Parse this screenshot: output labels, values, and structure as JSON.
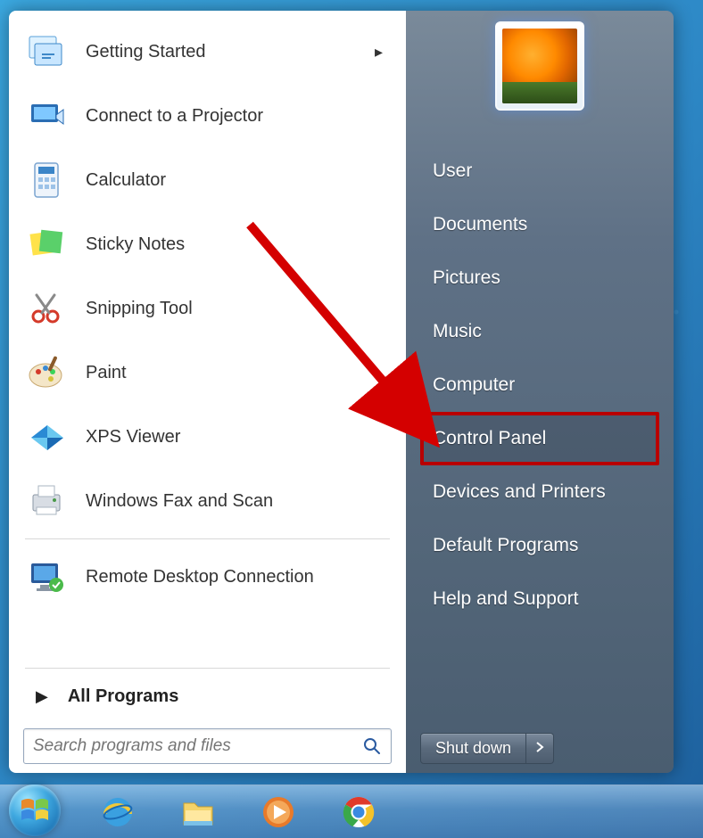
{
  "start_menu": {
    "programs": [
      {
        "label": "Getting Started",
        "has_submenu": true,
        "icon": "getting-started"
      },
      {
        "label": "Connect to a Projector",
        "has_submenu": false,
        "icon": "projector"
      },
      {
        "label": "Calculator",
        "has_submenu": false,
        "icon": "calculator"
      },
      {
        "label": "Sticky Notes",
        "has_submenu": false,
        "icon": "sticky-notes"
      },
      {
        "label": "Snipping Tool",
        "has_submenu": false,
        "icon": "snipping-tool"
      },
      {
        "label": "Paint",
        "has_submenu": false,
        "icon": "paint"
      },
      {
        "label": "XPS Viewer",
        "has_submenu": false,
        "icon": "xps-viewer"
      },
      {
        "label": "Windows Fax and Scan",
        "has_submenu": false,
        "icon": "fax-scan"
      },
      {
        "label": "Remote Desktop Connection",
        "has_submenu": false,
        "icon": "remote-desktop"
      }
    ],
    "separator_after_index": 7,
    "all_programs_label": "All Programs",
    "search_placeholder": "Search programs and files",
    "right_items": [
      {
        "label": "User",
        "highlighted": false
      },
      {
        "label": "Documents",
        "highlighted": false
      },
      {
        "label": "Pictures",
        "highlighted": false
      },
      {
        "label": "Music",
        "highlighted": false
      },
      {
        "label": "Computer",
        "highlighted": false
      },
      {
        "label": "Control Panel",
        "highlighted": true
      },
      {
        "label": "Devices and Printers",
        "highlighted": false
      },
      {
        "label": "Default Programs",
        "highlighted": false
      },
      {
        "label": "Help and Support",
        "highlighted": false
      }
    ],
    "shutdown_label": "Shut down"
  },
  "annotation": {
    "arrow_color": "#d40000",
    "target": "Control Panel"
  },
  "taskbar": {
    "items": [
      "start",
      "internet-explorer",
      "file-explorer",
      "windows-media-player",
      "google-chrome"
    ]
  }
}
